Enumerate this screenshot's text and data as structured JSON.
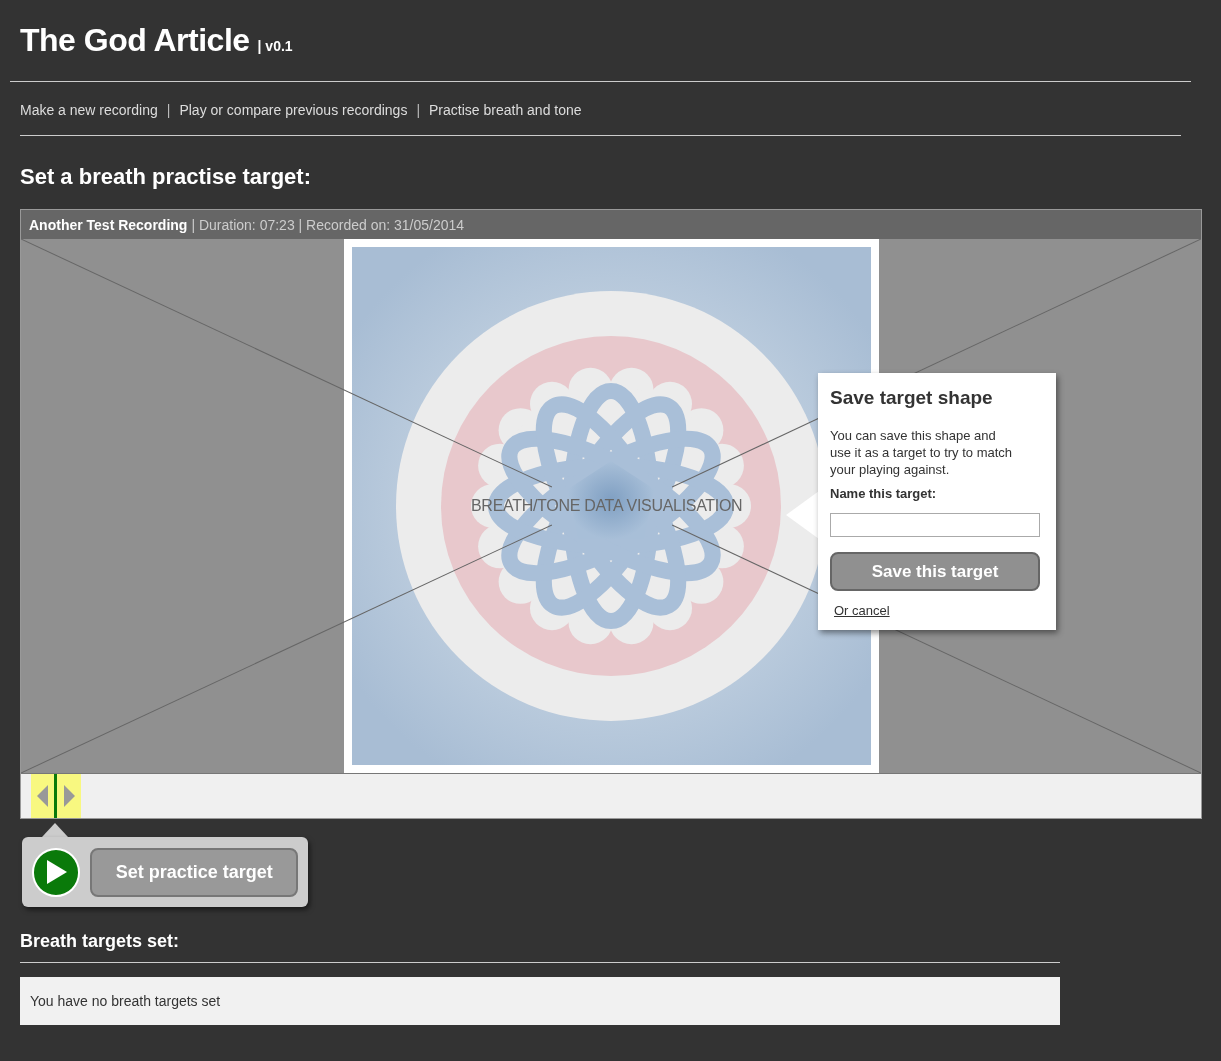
{
  "header": {
    "title": "The God Article",
    "version": "| v0.1"
  },
  "nav": [
    {
      "kind": "link",
      "label": "Make a new recording"
    },
    {
      "kind": "separator",
      "label": "|"
    },
    {
      "kind": "link",
      "label": "Play or compare previous recordings"
    },
    {
      "kind": "separator",
      "label": "|"
    },
    {
      "kind": "link",
      "label": "Practise breath and tone"
    }
  ],
  "section_title": "Set a breath practise target:",
  "recording": {
    "name": "Another Test Recording",
    "details": "| Duration: 07:23 | Recorded on: 31/05/2014",
    "visualisation_label": "BREATH/TONE DATA VISUALISATION"
  },
  "save_popover": {
    "title": "Save target shape",
    "text": "You can save this shape and use it as a target to try to match your playing against.",
    "field_label": "Name this target:",
    "save_button": "Save this target",
    "cancel_link": "Or cancel"
  },
  "timeline": {
    "level": 0.029
  },
  "controls": {
    "set_target_button": "Set practice target"
  },
  "targets": {
    "title": "Breath targets set:",
    "empty_message": "You have no breath targets set"
  }
}
